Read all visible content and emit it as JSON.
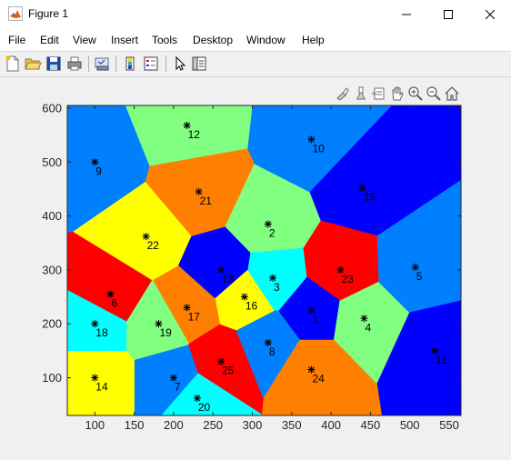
{
  "window": {
    "title": "Figure 1",
    "controls": [
      "minimize-icon",
      "maximize-icon",
      "close-icon"
    ]
  },
  "menu": {
    "items": [
      "File",
      "Edit",
      "View",
      "Insert",
      "Tools",
      "Desktop",
      "Window",
      "Help"
    ],
    "dock_glyph": "↘"
  },
  "toolbar": {
    "buttons": [
      "new-figure-icon",
      "open-file-icon",
      "save-icon",
      "print-icon",
      "link-plot-icon",
      "insert-colorbar-icon",
      "insert-legend-icon",
      "edit-plot-icon",
      "property-inspector-icon"
    ]
  },
  "axes_toolbar": {
    "buttons": [
      "brush-icon",
      "data-tips-icon",
      "export-icon",
      "pan-icon",
      "zoom-in-icon",
      "zoom-out-icon",
      "home-icon"
    ]
  },
  "chart_data": {
    "type": "scatter",
    "title": "",
    "xlabel": "",
    "ylabel": "",
    "xlim": [
      65,
      565
    ],
    "ylim": [
      30,
      605
    ],
    "xticks": [
      100,
      150,
      200,
      250,
      300,
      350,
      400,
      450,
      500,
      550
    ],
    "yticks": [
      100,
      200,
      300,
      400,
      500,
      600
    ],
    "grid": false,
    "marker": "*",
    "points": [
      {
        "label": "1",
        "x": 375,
        "y": 225,
        "color": "#0000ff"
      },
      {
        "label": "2",
        "x": 320,
        "y": 385,
        "color": "#80ff80"
      },
      {
        "label": "3",
        "x": 326,
        "y": 285,
        "color": "#00ffff"
      },
      {
        "label": "4",
        "x": 442,
        "y": 210,
        "color": "#80ff80"
      },
      {
        "label": "5",
        "x": 507,
        "y": 305,
        "color": "#0080ff"
      },
      {
        "label": "6",
        "x": 120,
        "y": 255,
        "color": "#ff0000"
      },
      {
        "label": "7",
        "x": 200,
        "y": 100,
        "color": "#0080ff"
      },
      {
        "label": "8",
        "x": 320,
        "y": 165,
        "color": "#0080ff"
      },
      {
        "label": "9",
        "x": 100,
        "y": 500,
        "color": "#0080ff"
      },
      {
        "label": "10",
        "x": 375,
        "y": 542,
        "color": "#0080ff"
      },
      {
        "label": "11",
        "x": 532,
        "y": 150,
        "color": "#0000ff"
      },
      {
        "label": "12",
        "x": 217,
        "y": 568,
        "color": "#80ff80"
      },
      {
        "label": "13",
        "x": 260,
        "y": 300,
        "color": "#0000ff"
      },
      {
        "label": "14",
        "x": 100,
        "y": 100,
        "color": "#ffff00"
      },
      {
        "label": "15",
        "x": 440,
        "y": 452,
        "color": "#0000ff"
      },
      {
        "label": "16",
        "x": 290,
        "y": 250,
        "color": "#ffff00"
      },
      {
        "label": "17",
        "x": 217,
        "y": 230,
        "color": "#ff8000"
      },
      {
        "label": "18",
        "x": 100,
        "y": 200,
        "color": "#00ffff"
      },
      {
        "label": "19",
        "x": 181,
        "y": 200,
        "color": "#80ff80"
      },
      {
        "label": "20",
        "x": 230,
        "y": 62,
        "color": "#00ffff"
      },
      {
        "label": "21",
        "x": 232,
        "y": 445,
        "color": "#ff8000"
      },
      {
        "label": "22",
        "x": 165,
        "y": 362,
        "color": "#ffff00"
      },
      {
        "label": "23",
        "x": 412,
        "y": 300,
        "color": "#ff0000"
      },
      {
        "label": "24",
        "x": 375,
        "y": 115,
        "color": "#ff8000"
      },
      {
        "label": "25",
        "x": 260,
        "y": 130,
        "color": "#ff0000"
      }
    ]
  }
}
